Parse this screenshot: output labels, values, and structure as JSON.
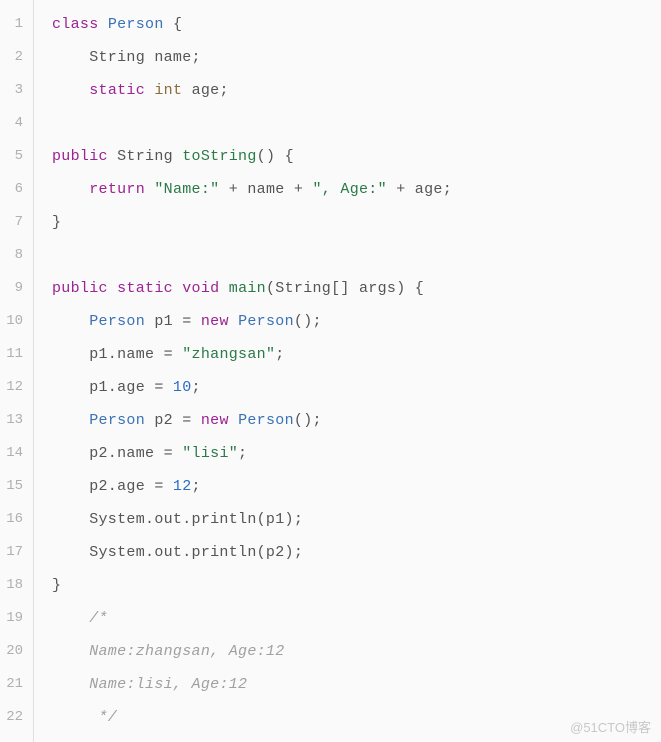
{
  "watermark": "@51CTO博客",
  "code": {
    "lines": [
      {
        "n": 1,
        "seg": [
          {
            "t": "class ",
            "c": "kw-decl"
          },
          {
            "t": "Person ",
            "c": "type-name"
          },
          {
            "t": "{",
            "c": "punct"
          }
        ]
      },
      {
        "n": 2,
        "seg": [
          {
            "t": "    String name;",
            "c": "plain"
          }
        ]
      },
      {
        "n": 3,
        "seg": [
          {
            "t": "    ",
            "c": "plain"
          },
          {
            "t": "static ",
            "c": "kw-decl"
          },
          {
            "t": "int ",
            "c": "kw-type"
          },
          {
            "t": "age;",
            "c": "plain"
          }
        ]
      },
      {
        "n": 4,
        "seg": [
          {
            "t": "",
            "c": "plain"
          }
        ]
      },
      {
        "n": 5,
        "seg": [
          {
            "t": "public ",
            "c": "kw-mod"
          },
          {
            "t": "String ",
            "c": "plain"
          },
          {
            "t": "toString",
            "c": "method-name"
          },
          {
            "t": "() {",
            "c": "plain"
          }
        ]
      },
      {
        "n": 6,
        "seg": [
          {
            "t": "    ",
            "c": "plain"
          },
          {
            "t": "return ",
            "c": "kw-decl"
          },
          {
            "t": "\"Name:\"",
            "c": "string"
          },
          {
            "t": " + name + ",
            "c": "plain"
          },
          {
            "t": "\", Age:\"",
            "c": "string"
          },
          {
            "t": " + age;",
            "c": "plain"
          }
        ]
      },
      {
        "n": 7,
        "seg": [
          {
            "t": "}",
            "c": "punct"
          }
        ]
      },
      {
        "n": 8,
        "seg": [
          {
            "t": "",
            "c": "plain"
          }
        ]
      },
      {
        "n": 9,
        "seg": [
          {
            "t": "public ",
            "c": "kw-mod"
          },
          {
            "t": "static ",
            "c": "kw-decl"
          },
          {
            "t": "void ",
            "c": "kw-decl"
          },
          {
            "t": "main",
            "c": "method-name"
          },
          {
            "t": "(String[] args) {",
            "c": "plain"
          }
        ]
      },
      {
        "n": 10,
        "seg": [
          {
            "t": "    ",
            "c": "plain"
          },
          {
            "t": "Person ",
            "c": "type-name"
          },
          {
            "t": "p1 = ",
            "c": "plain"
          },
          {
            "t": "new ",
            "c": "kw-decl"
          },
          {
            "t": "Person",
            "c": "type-name"
          },
          {
            "t": "();",
            "c": "plain"
          }
        ]
      },
      {
        "n": 11,
        "seg": [
          {
            "t": "    p1.name = ",
            "c": "plain"
          },
          {
            "t": "\"zhangsan\"",
            "c": "string"
          },
          {
            "t": ";",
            "c": "plain"
          }
        ]
      },
      {
        "n": 12,
        "seg": [
          {
            "t": "    p1.age = ",
            "c": "plain"
          },
          {
            "t": "10",
            "c": "number"
          },
          {
            "t": ";",
            "c": "plain"
          }
        ]
      },
      {
        "n": 13,
        "seg": [
          {
            "t": "    ",
            "c": "plain"
          },
          {
            "t": "Person ",
            "c": "type-name"
          },
          {
            "t": "p2 = ",
            "c": "plain"
          },
          {
            "t": "new ",
            "c": "kw-decl"
          },
          {
            "t": "Person",
            "c": "type-name"
          },
          {
            "t": "();",
            "c": "plain"
          }
        ]
      },
      {
        "n": 14,
        "seg": [
          {
            "t": "    p2.name = ",
            "c": "plain"
          },
          {
            "t": "\"lisi\"",
            "c": "string"
          },
          {
            "t": ";",
            "c": "plain"
          }
        ]
      },
      {
        "n": 15,
        "seg": [
          {
            "t": "    p2.age = ",
            "c": "plain"
          },
          {
            "t": "12",
            "c": "number"
          },
          {
            "t": ";",
            "c": "plain"
          }
        ]
      },
      {
        "n": 16,
        "seg": [
          {
            "t": "    System.out.println(p1);",
            "c": "plain"
          }
        ]
      },
      {
        "n": 17,
        "seg": [
          {
            "t": "    System.out.println(p2);",
            "c": "plain"
          }
        ]
      },
      {
        "n": 18,
        "seg": [
          {
            "t": "}",
            "c": "punct"
          }
        ]
      },
      {
        "n": 19,
        "seg": [
          {
            "t": "    /*",
            "c": "comment"
          }
        ]
      },
      {
        "n": 20,
        "seg": [
          {
            "t": "    Name:zhangsan, Age:12",
            "c": "comment"
          }
        ]
      },
      {
        "n": 21,
        "seg": [
          {
            "t": "    Name:lisi, Age:12",
            "c": "comment"
          }
        ]
      },
      {
        "n": 22,
        "seg": [
          {
            "t": "     */",
            "c": "comment"
          }
        ]
      }
    ]
  }
}
